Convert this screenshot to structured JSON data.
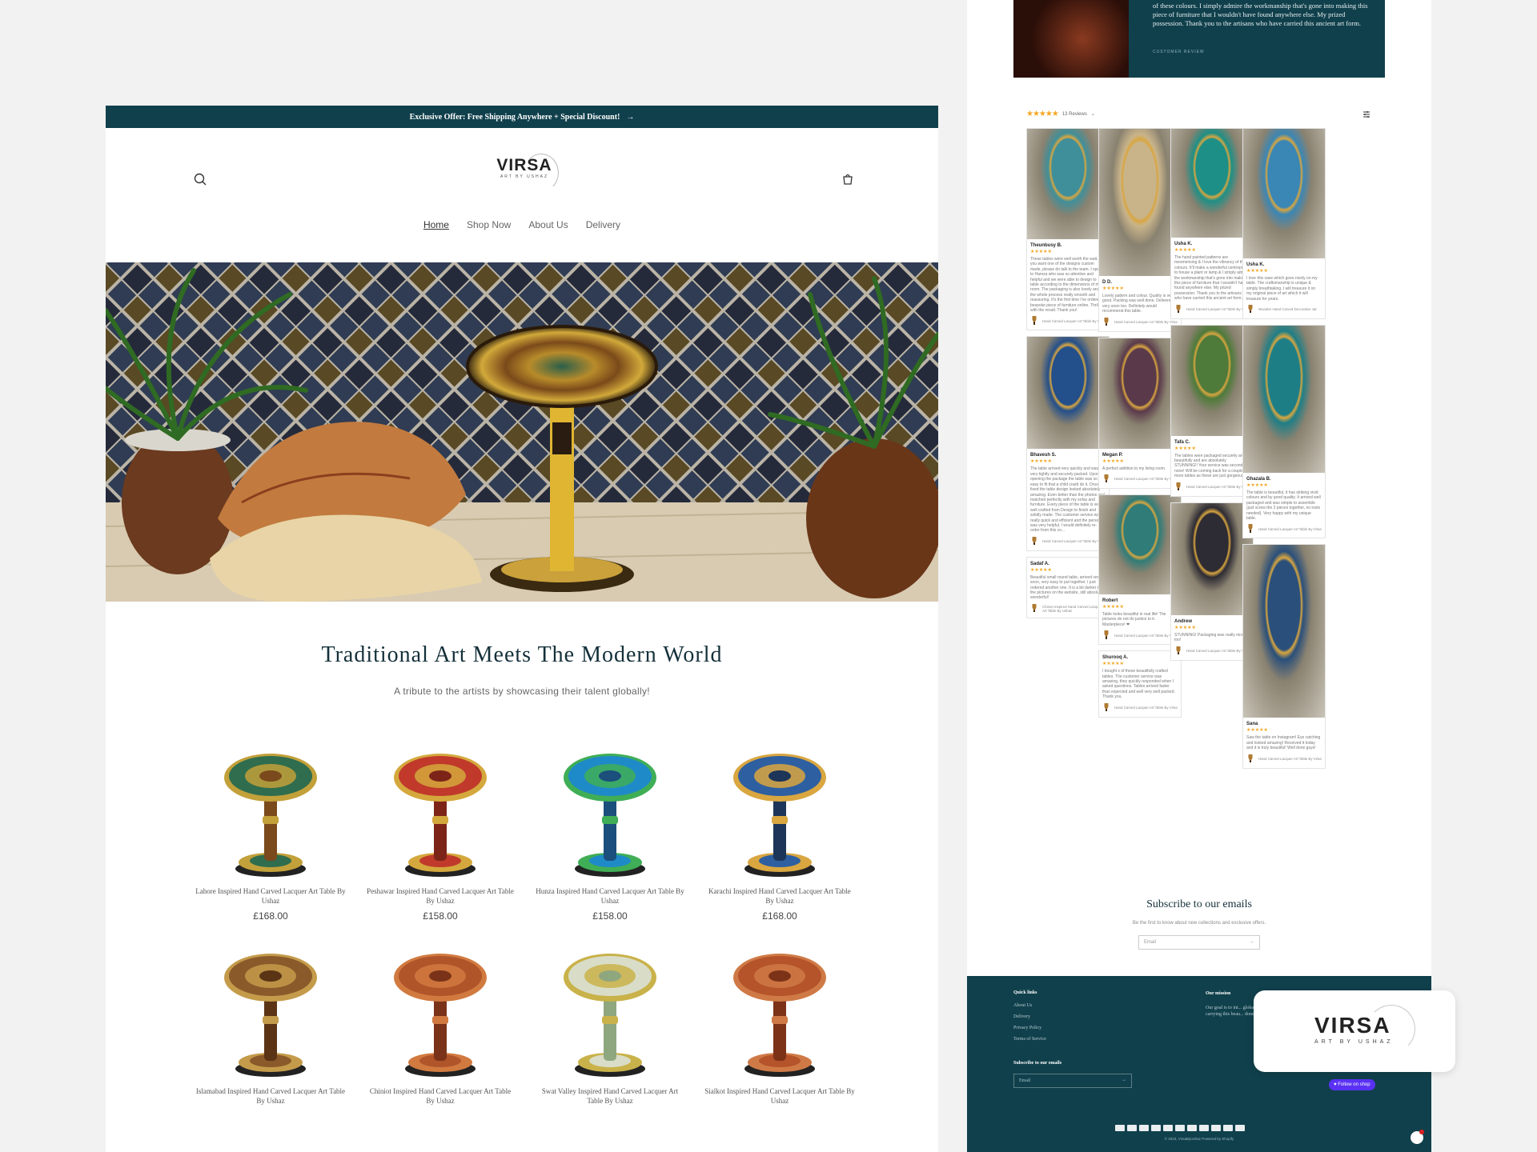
{
  "left": {
    "announcement": "Exclusive Offer: Free Shipping Anywhere + Special Discount!",
    "logo": {
      "main": "VIRSA",
      "sub": "ART BY USHAZ"
    },
    "nav": [
      {
        "label": "Home",
        "active": true
      },
      {
        "label": "Shop Now",
        "active": false
      },
      {
        "label": "About Us",
        "active": false
      },
      {
        "label": "Delivery",
        "active": false
      }
    ],
    "heading": "Traditional Art Meets The Modern World",
    "subheading": "A tribute to the artists by showcasing their talent globally!",
    "products": [
      {
        "title": "Lahore Inspired Hand Carved Lacquer Art Table By Ushaz",
        "price": "£168.00",
        "top": "#2f6d4e",
        "ring": "#c2a03a",
        "center": "#7a4a1c"
      },
      {
        "title": "Peshawar Inspired Hand Carved Lacquer Art Table By Ushaz",
        "price": "£158.00",
        "top": "#c0392b",
        "ring": "#d4a83c",
        "center": "#7d2418"
      },
      {
        "title": "Hunza Inspired Hand Carved Lacquer Art Table By Ushaz",
        "price": "£158.00",
        "top": "#1f8ac8",
        "ring": "#3fae56",
        "center": "#1b4f7c"
      },
      {
        "title": "Karachi Inspired Hand Carved Lacquer Art Table By Ushaz",
        "price": "£168.00",
        "top": "#2e5fa0",
        "ring": "#d9a640",
        "center": "#1c3559"
      },
      {
        "title": "Islamabad Inspired Hand Carved Lacquer Art Table By Ushaz",
        "price": "",
        "top": "#8a5a2b",
        "ring": "#c49b4a",
        "center": "#5a3415"
      },
      {
        "title": "Chiniot Inspired Hand Carved Lacquer Art Table By Ushaz",
        "price": "",
        "top": "#b0542a",
        "ring": "#d17a40",
        "center": "#7a3318"
      },
      {
        "title": "Swat Valley Inspired Hand Carved Lacquer Art Table By Ushaz",
        "price": "",
        "top": "#d9ddc8",
        "ring": "#c9b24a",
        "center": "#8fa77e"
      },
      {
        "title": "Sialkot Inspired Hand Carved Lacquer Art Table By Ushaz",
        "price": "",
        "top": "#b5532a",
        "ring": "#cf7a46",
        "center": "#7c3217"
      }
    ]
  },
  "right": {
    "testimonial": {
      "quote": "of these colours. I simply admire the workmanship that's gone into making this piece of furniture that I wouldn't have found anywhere else. My prized possession. Thank you to the artisans who have carried this ancient art form.",
      "caption": "CUSTOMER REVIEW"
    },
    "reviews_count": "13 Reviews",
    "review_columns": [
      [
        {
          "name": "Theunbusy B.",
          "stars": "★★★★★",
          "text": "These tables were well worth the wait. If you want one of the designs custom made, please do talk to the team. I spoke to Hamza who was so attentive and helpful and we were able to design to table according to the dimensions of my room. The packaging is also lovely and the whole process really smooth and reassuring. It's the first time I've ordered a bespoke piece of furniture online. Thrilled with the result. Thank you!",
          "product": "Hand Carved Lacquer Art Table By Virsa",
          "img": "#3f8f9a",
          "h": 138
        },
        {
          "name": "Bhavesh S.",
          "stars": "★★★★★",
          "text": "The table arrived very quickly and was very tightly and securely packed. Upon opening the package the table was so easy to fit that a child could do it. Once fixed the table design looked absolutely amazing. Even better than the photos and matched perfectly with my sofas and furniture. Every piece of the table is very well crafted from Design to finish and solidly made. The customer service was really quick and efficient and the person was very helpful. I would definitely re-order from this co...",
          "product": "Hand Carved Lacquer Art Table By Virsa",
          "img": "#234f8a",
          "h": 140
        },
        {
          "name": "Sadaf A.",
          "stars": "★★★★★",
          "text": "Beautiful small round table, arrived very soon, very easy to put together. I just ordered another one. It is a bit darker than the pictures on the website, still absolutely wonderful!",
          "product": "Chiniot Inspired Hand Carved Lacquer Art Table By Ushaz",
          "img": "",
          "h": 0
        }
      ],
      [
        {
          "name": "D D.",
          "stars": "★★★★★",
          "text": "Lovely pattern and colour. Quality is very good. Packing was well done. Delivered very soon too. Definitely would recommend this table.",
          "product": "Hand Carved Lacquer Art Table By Virsa",
          "img": "#c9b48a",
          "h": 184
        },
        {
          "name": "Megan P.",
          "stars": "★★★★★",
          "text": "A perfect addition to my living room.",
          "product": "Hand Carved Lacquer Art Table By Virsa",
          "img": "#5a3a4a",
          "h": 138
        },
        {
          "name": "Robert",
          "stars": "★★★★★",
          "text": "Table looks beautiful in real life! The pictures do not do justice to it. Masterpiece! ❤",
          "product": "Hand Carved Lacquer Art Table By Virsa",
          "img": "#2f7c78",
          "h": 124
        },
        {
          "name": "Shurooq A.",
          "stars": "★★★★★",
          "text": "I bought x of these beautifully crafted tables. The customer service was amazing, they quickly responded when I asked questions. Tables arrived faster than expected and well very well packed. Thank you.",
          "product": "Hand Carved Lacquer Art Table By Virsa",
          "img": "",
          "h": 0
        }
      ],
      [
        {
          "name": "Usha K.",
          "stars": "★★★★★",
          "text": "The hand painted patterns are mesmerising & I love the vibrancy of these colours. It'll make a wonderful centrepiece to house a plant or lamp & I simply admire the workmanship that's gone into making this piece of furniture that I wouldn't have found anywhere else. My prized possession. Thank you to the artisans who have carried this ancient art form.",
          "product": "Hand Carved Lacquer Art Table By Virsa",
          "img": "#1e8f86",
          "h": 136
        },
        {
          "name": "Tafa C.",
          "stars": "★★★★★",
          "text": "The tables were packaged securely and beautifully and are absolutely STUNNING!! Your service was second to none! Will be coming back for a couple more tables as these are just gorgeous.",
          "product": "Hand Carved Lacquer Art Table By Virsa",
          "img": "#4e7a3a",
          "h": 138
        },
        {
          "name": "Andrew",
          "stars": "★★★★★",
          "text": "STUNNING! Packaging was really nice too!",
          "product": "Hand Carved Lacquer Art Table By Virsa",
          "img": "#2d2b33",
          "h": 140
        }
      ],
      [
        {
          "name": "Usha K.",
          "stars": "★★★★★",
          "text": "I love this vase which goes nicely on my table. The craftsmanship is unique & simply breathtaking. I will treasure it on my original piece of art which it will treasure for years.",
          "product": "Wooden Hand Carved Decorative Jar",
          "img": "#3a86b5",
          "h": 162
        },
        {
          "name": "Ghazala B.",
          "stars": "★★★★★",
          "text": "The table is beautiful, it has striking vivid colours and by good quality. It arrived well packaged and was simple to assemble (just screw the 2 pieces together, no tools needed). Very happy with my unique table.",
          "product": "Hand Carved Lacquer Art Table By Virsa",
          "img": "#1e7e86",
          "h": 184
        },
        {
          "name": "Sana",
          "stars": "★★★★★",
          "text": "Saw the table on Instagram! Eye catching and looked amazing! Received it today and it is truly beautiful! Well done guys!",
          "product": "Hand Carved Lacquer Art Table By Virsa",
          "img": "#2a4f7a",
          "h": 216
        }
      ]
    ],
    "subscribe": {
      "title": "Subscribe to our emails",
      "desc": "Be the first to know about new collections and exclusive offers.",
      "placeholder": "Email"
    },
    "footer": {
      "quick_links_title": "Quick links",
      "quick_links": [
        "About Us",
        "Delivery",
        "Privacy Policy",
        "Terms of Service"
      ],
      "subscribe_title": "Subscribe to our emails",
      "email_placeholder": "Email",
      "mission_title": "Our mission",
      "mission_text": "Our goal is to int... global market. W... carrying this beau... done by showca...",
      "follow_label": "♥ Follow on shop",
      "copyright": "© 2023, VirsaByUshaz Powered by Shopify"
    },
    "logo_badge": {
      "main": "VIRSA",
      "sub": "ART BY USHAZ"
    }
  }
}
